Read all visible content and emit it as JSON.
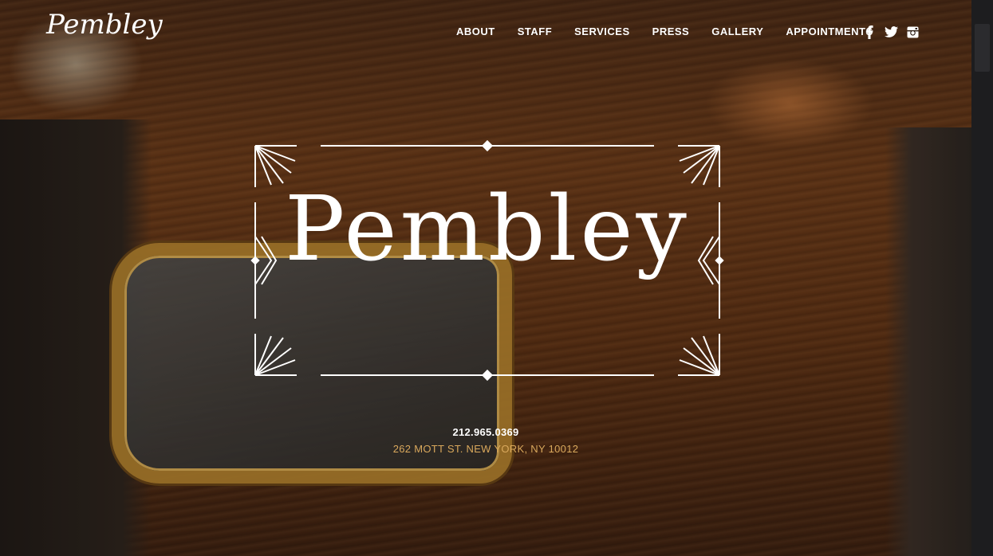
{
  "header": {
    "logo_text": "Pembley",
    "nav": [
      {
        "label": "ABOUT"
      },
      {
        "label": "STAFF"
      },
      {
        "label": "SERVICES"
      },
      {
        "label": "PRESS"
      },
      {
        "label": "GALLERY"
      },
      {
        "label": "APPOINTMENTS"
      }
    ],
    "social": [
      {
        "icon": "facebook-icon"
      },
      {
        "icon": "twitter-icon"
      },
      {
        "icon": "instagram-icon"
      }
    ]
  },
  "hero": {
    "title": "Pembley"
  },
  "contact": {
    "phone": "212.965.0369",
    "address": "262 MOTT ST. NEW YORK, NY 10012"
  },
  "colors": {
    "text": "#ffffff",
    "address": "#d9a85c",
    "wood": "#6a3a18",
    "gold": "#b8862f"
  }
}
